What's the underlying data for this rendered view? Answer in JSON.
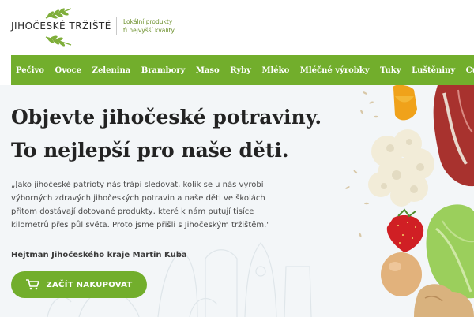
{
  "header": {
    "logo_text": "JIHOČESKÉ TRŽIŠTĚ",
    "tagline_line1": "Lokální produkty",
    "tagline_line2": "ťi nejvyšší kvality..."
  },
  "nav": {
    "items": [
      "Pečivo",
      "Ovoce",
      "Zelenina",
      "Brambory",
      "Maso",
      "Ryby",
      "Mléko",
      "Mléčné výrobky",
      "Tuky",
      "Luštěniny",
      "Cukry"
    ]
  },
  "hero": {
    "title_line1": "Objevte jihočeské potraviny.",
    "title_line2": "To nejlepší pro naše děti.",
    "quote_line1": "„Jako jihočeské patrioty nás trápí sledovat, kolik se u nás vyrobí",
    "quote_line2": "výborných zdravých jihočeských potravin a naše děti ve školách",
    "quote_line3": "přitom dostávají dotované produkty, které k nám putují tisíce",
    "quote_line4": "kilometrů přes půl světa. Proto jsme přišli s Jihočeským tržištěm.\"",
    "author": "Hejtman Jihočeského kraje Martin Kuba",
    "cta_label": "ZAČÍT NAKUPOVAT"
  },
  "colors": {
    "brand_green": "#72ae2c",
    "hero_bg": "#f3f6f8",
    "title_text": "#232323"
  },
  "icons": {
    "cart": "cart-icon",
    "logo_leaf": "leaf-icon"
  }
}
